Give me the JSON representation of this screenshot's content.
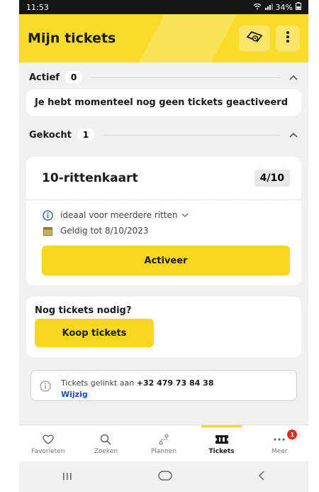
{
  "status_bar": {
    "time": "11:53",
    "battery": "34%"
  },
  "header": {
    "title": "Mijn tickets"
  },
  "active_section": {
    "label": "Actief",
    "count": "0",
    "empty_message": "Je hebt momenteel nog geen tickets geactiveerd"
  },
  "bought_section": {
    "label": "Gekocht",
    "count": "1"
  },
  "ticket": {
    "name": "10-rittenkaart",
    "rides": "4/10",
    "description": "ideaal voor meerdere ritten",
    "validity": "Geldig tot 8/10/2023",
    "activate_label": "Activeer"
  },
  "more_tickets": {
    "title": "Nog tickets nodig?",
    "buy_label": "Koop tickets"
  },
  "link_info": {
    "text": "Tickets gelinkt aan",
    "phone": "+32 479 73 84 38",
    "link": "Wijzig"
  },
  "tabs": [
    {
      "label": "Favorieten",
      "icon": "heart-icon"
    },
    {
      "label": "Zoeken",
      "icon": "search-icon"
    },
    {
      "label": "Plannen",
      "icon": "route-icon"
    },
    {
      "label": "Tickets",
      "icon": "ticket-icon"
    },
    {
      "label": "Meer",
      "icon": "more-icon",
      "badge": "1"
    }
  ],
  "colors": {
    "accent": "#f9d61f",
    "header": "#f9db2a",
    "link": "#1e4fb8",
    "badge": "#d92d20"
  }
}
